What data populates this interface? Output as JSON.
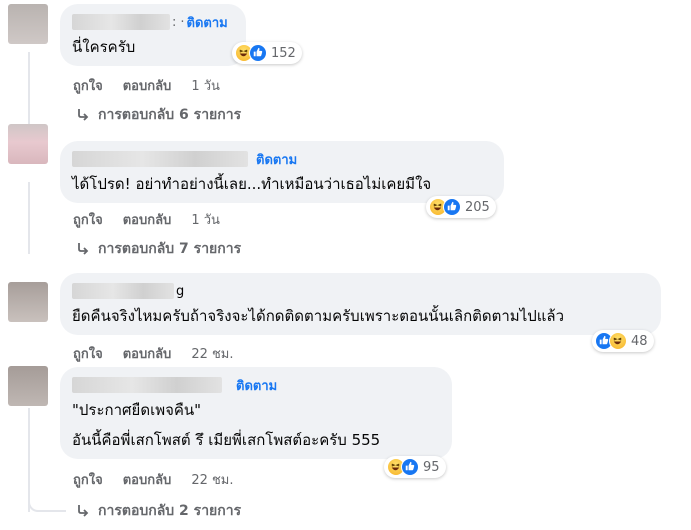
{
  "comments": [
    {
      "name_suffix": ":",
      "separator": "·",
      "follow_label": "ติดตาม",
      "lines": [
        "นี่ใครครับ"
      ],
      "reactions": [
        "haha",
        "like"
      ],
      "reaction_count": "152",
      "actions": {
        "like": "ถูกใจ",
        "reply": "ตอบกลับ",
        "time": "1 วัน"
      },
      "replies_label": "การตอบกลับ 6 รายการ"
    },
    {
      "name_suffix": "",
      "follow_label": "ติดตาม",
      "lines": [
        "ได้โปรด! อย่าทำอย่างนี้เลย...ทำเหมือนว่าเธอไม่เคยมีใจ"
      ],
      "reactions": [
        "haha",
        "like"
      ],
      "reaction_count": "205",
      "actions": {
        "like": "ถูกใจ",
        "reply": "ตอบกลับ",
        "time": "1 วัน"
      },
      "replies_label": "การตอบกลับ 7 รายการ"
    },
    {
      "name_suffix": "g",
      "lines": [
        "ยืดคืนจริงไหมครับถ้าจริงจะได้กดติดตามครับเพราะตอนนั้นเลิกติดตามไปแล้ว"
      ],
      "reactions": [
        "like",
        "haha"
      ],
      "reaction_count": "48",
      "actions": {
        "like": "ถูกใจ",
        "reply": "ตอบกลับ",
        "time": "22 ชม."
      }
    },
    {
      "name_suffix": "",
      "follow_label": "ติดตาม",
      "lines": [
        "\"ประกาศยืดเพจคืน\"",
        "อันนี้คือพี่เสกโพสต์ รึ เมียพี่เสกโพสต์อะครับ 555"
      ],
      "reactions": [
        "haha",
        "like"
      ],
      "reaction_count": "95",
      "actions": {
        "like": "ถูกใจ",
        "reply": "ตอบกลับ",
        "time": "22 ชม."
      },
      "replies_label": "การตอบกลับ 2 รายการ"
    }
  ],
  "colors": {
    "bubble": "#f0f2f5",
    "follow": "#1877f2",
    "secondary_text": "#65676b",
    "like": "#1877f2",
    "haha": "#f7b125"
  },
  "icons": {
    "reply_arrow": "reply-arrow-icon",
    "haha": "haha-reaction-icon",
    "like": "like-reaction-icon"
  }
}
